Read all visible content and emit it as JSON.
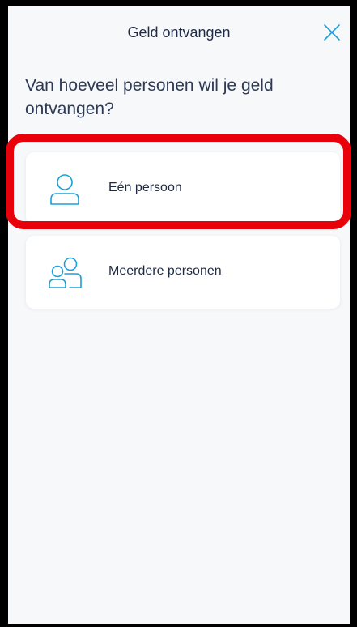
{
  "header": {
    "title": "Geld ontvangen",
    "close_icon": "close-icon"
  },
  "question": "Van hoeveel personen wil je geld ontvangen?",
  "options": [
    {
      "label": "Eén persoon",
      "icon": "person-icon"
    },
    {
      "label": "Meerdere personen",
      "icon": "people-icon"
    }
  ],
  "colors": {
    "accent": "#1aa0d8",
    "highlight": "#e8000b",
    "text": "#1f2a44",
    "background": "#f7f8fa"
  }
}
